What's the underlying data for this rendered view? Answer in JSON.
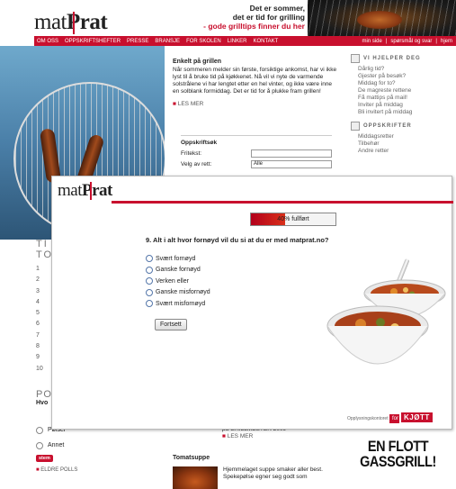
{
  "site": {
    "logo": {
      "mat": "mat",
      "prat": "Prat"
    },
    "slogan": {
      "line1": "Det er sommer,",
      "line2": "det er tid for grilling",
      "line3": "- gode grilltips finner du her"
    },
    "nav": {
      "items": [
        "OM OSS",
        "OPPSKRIFTSHEFTER",
        "PRESSE",
        "BRANSJE",
        "FOR SKOLEN",
        "LINKER",
        "KONTAKT"
      ],
      "right": [
        "min side",
        "spørsmål og svar",
        "hjem"
      ]
    },
    "article": {
      "title": "Enkelt på grillen",
      "body": "Når sommeren melder sin første, forsiktige ankomst, har vi ikke lyst til å bruke tid på kjøkkenet. Nå vil vi nyte de varmende solstrålene vi har lengtet etter en hel vinter, og ikke være inne en solblank formiddag. Det er tid for å plukke fram grillen!",
      "more": "LES MER"
    },
    "recipe_search": {
      "title": "Oppskriftsøk",
      "free_text_label": "Fritekst:",
      "dish_label": "Velg av rett:",
      "dish_value": "Alle"
    },
    "sidebar": {
      "help_title": "VI HJELPER DEG",
      "help_links": [
        "Dårlig tid?",
        "Gjester på besøk?",
        "Middag for to?",
        "De magreste rettene",
        "Få mattips på mail!",
        "Inviter på middag",
        "Bli invitert på middag"
      ],
      "recipes_title": "OPPSKRIFTER",
      "recipe_links": [
        "Middagsretter",
        "Tilbehør",
        "Andre retter"
      ]
    },
    "topten": {
      "title_line1": "TI",
      "title_line2": "TO",
      "numbers": [
        "1",
        "2",
        "3",
        "4",
        "5",
        "6",
        "7",
        "8",
        "9",
        "10"
      ]
    },
    "poll": {
      "title": "PO",
      "question": "Hvo",
      "options": [
        "Pølser",
        "Annet"
      ],
      "vote": "stem",
      "older": "ELDRE POLLS"
    },
    "lower_article": {
      "teaser": "på GRILLMESTER 2009",
      "more": "LES MER",
      "title": "Tomatsuppe",
      "body": "Hjemmelaget suppe smaker aller best. Spekepølse egner seg godt som"
    },
    "ad": {
      "line1": "EN FLOTT",
      "line2": "GASSGRILL!"
    }
  },
  "survey": {
    "logo": {
      "mat": "mat",
      "prat": "Prat"
    },
    "progress": {
      "percent": 40,
      "label": "40% fullført"
    },
    "question": "9. Alt i alt hvor fornøyd vil du si at du er med matprat.no?",
    "options": [
      "Svært fornøyd",
      "Ganske fornøyd",
      "Verken eller",
      "Ganske misfornøyd",
      "Svært misfornøyd"
    ],
    "next_label": "Fortsett",
    "footer": {
      "text": "Opplysningskontoret",
      "for": "for",
      "brand": "KJØTT"
    }
  }
}
